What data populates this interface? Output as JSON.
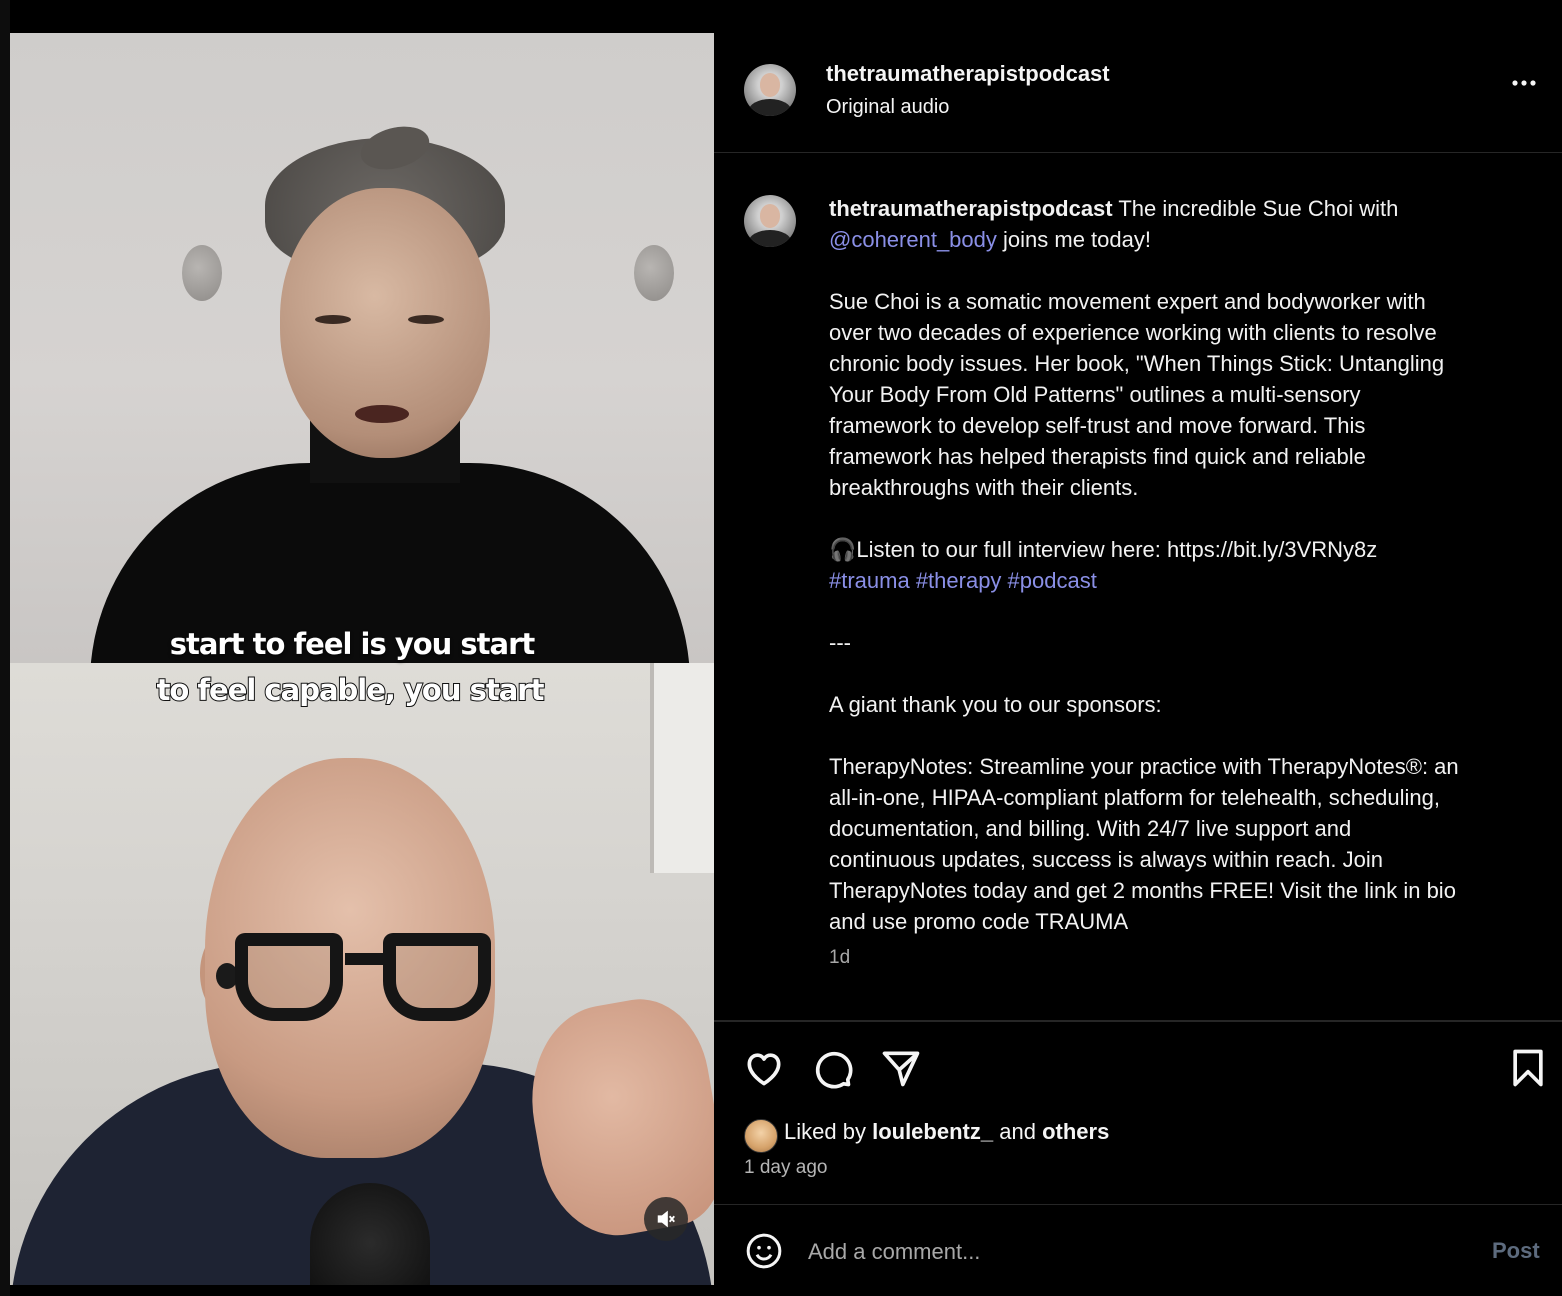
{
  "video": {
    "captions": [
      "start to feel is you start",
      "to feel capable, you start"
    ],
    "mute_icon": "speaker-muted-icon"
  },
  "header": {
    "username": "thetraumatherapistpodcast",
    "audio": "Original audio",
    "more_icon": "ellipsis-icon"
  },
  "post": {
    "username": "thetraumatherapistpodcast",
    "intro": "The incredible Sue Choi with",
    "mention": "@coherent_body",
    "intro_end": "joins me today!",
    "bio": "Sue Choi is a somatic movement expert and bodyworker with\nover two decades of experience working with clients to resolve\nchronic body issues. Her book, \"When Things Stick: Untangling\nYour Body From Old Patterns\" outlines a multi-sensory\nframework to develop self-trust and move forward. This\nframework has helped therapists find quick and reliable\nbreakthroughs with their clients.",
    "listen": "🎧Listen to our full interview here: https://bit.ly/3VRNy8z",
    "hashtags": "#trauma #therapy #podcast",
    "separator": "---",
    "sponsors_intro": "A giant thank you to our sponsors:",
    "sponsor_text": "TherapyNotes: Streamline your practice with TherapyNotes®: an\nall-in-one, HIPAA-compliant platform for telehealth, scheduling,\ndocumentation, and billing. With 24/7 live support and\ncontinuous updates, success is always within reach. Join\nTherapyNotes today and get 2 months FREE! Visit the link in bio\nand use promo code TRAUMA",
    "time": "1d"
  },
  "actions": {
    "like_icon": "heart-icon",
    "comment_icon": "comment-icon",
    "share_icon": "send-icon",
    "save_icon": "bookmark-icon"
  },
  "likes": {
    "prefix": "Liked by",
    "user": "loulebentz_",
    "mid": "and",
    "others": "others",
    "ago": "1 day ago"
  },
  "comment": {
    "emoji_icon": "smiley-icon",
    "placeholder": "Add a comment...",
    "post_label": "Post"
  }
}
